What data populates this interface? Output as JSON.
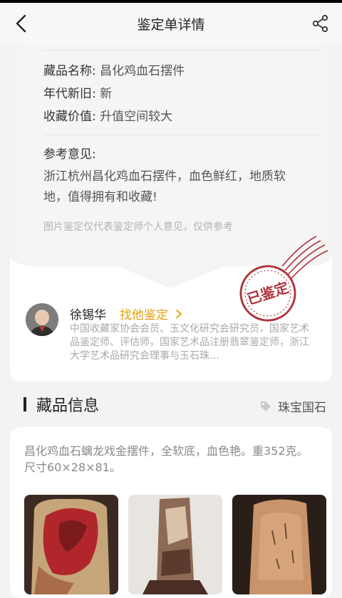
{
  "nav": {
    "title": "鉴定单详情",
    "back_icon": "chevron-left-icon",
    "share_icon": "share-icon"
  },
  "report": {
    "fields": [
      {
        "label": "藏品名称: ",
        "value": "昌化鸡血石摆件"
      },
      {
        "label": "年代新旧: ",
        "value": "新"
      },
      {
        "label": "收藏价值: ",
        "value": "升值空间较大"
      }
    ],
    "opinion_title": "参考意见:",
    "opinion_text": "浙江杭州昌化鸡血石摆件，血色鲜红，地质软地，值得拥有和收藏!",
    "disclaimer": "图片鉴定仅代表鉴定师个人意见，仅供参考",
    "stamp_text": "已鉴定",
    "stamp_color": "#b0353d"
  },
  "appraiser": {
    "name": "徐锡华",
    "link_label": "找他鉴定",
    "link_color": "#e5a00d",
    "description": "中国收藏家协会会员、玉文化研究会研究员，国家艺术品鉴定师、评估师，国家艺术品注册翡翠鉴定师，浙江大学艺术品研究会理事与玉石珠…"
  },
  "section": {
    "title": "藏品信息",
    "tag_icon": "tag-icon",
    "tag_label": "珠宝国石"
  },
  "item": {
    "description": "昌化鸡血石螭龙戏金摆件，全软底，血色艳。重352克。尺寸60×28×81。"
  }
}
